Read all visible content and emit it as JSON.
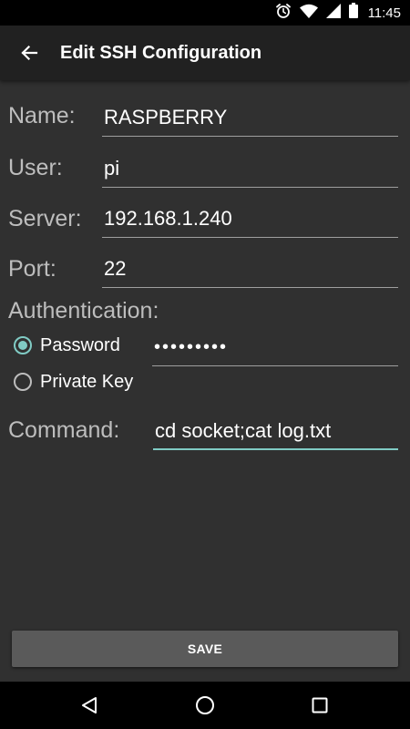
{
  "status_bar": {
    "time": "11:45",
    "icons": [
      "alarm-icon",
      "wifi-icon",
      "signal-icon",
      "battery-icon"
    ]
  },
  "app_bar": {
    "title": "Edit SSH Configuration",
    "back_icon": "arrow-back-icon"
  },
  "form": {
    "name_label": "Name:",
    "name_value": "RASPBERRY",
    "user_label": "User:",
    "user_value": "pi",
    "server_label": "Server:",
    "server_value": "192.168.1.240",
    "port_label": "Port:",
    "port_value": "22",
    "auth_label": "Authentication:",
    "auth_options": [
      {
        "label": "Password",
        "selected": true
      },
      {
        "label": "Private Key",
        "selected": false
      }
    ],
    "password_value": "•••••••••",
    "command_label": "Command:",
    "command_value": "cd socket;cat log.txt"
  },
  "save_label": "SAVE",
  "nav_bar": {
    "icons": [
      "back-triangle-icon",
      "home-circle-icon",
      "recents-square-icon"
    ]
  },
  "colors": {
    "background": "#303030",
    "app_bar": "#212121",
    "accent": "#80cbc4",
    "button": "#5a5a5a"
  }
}
